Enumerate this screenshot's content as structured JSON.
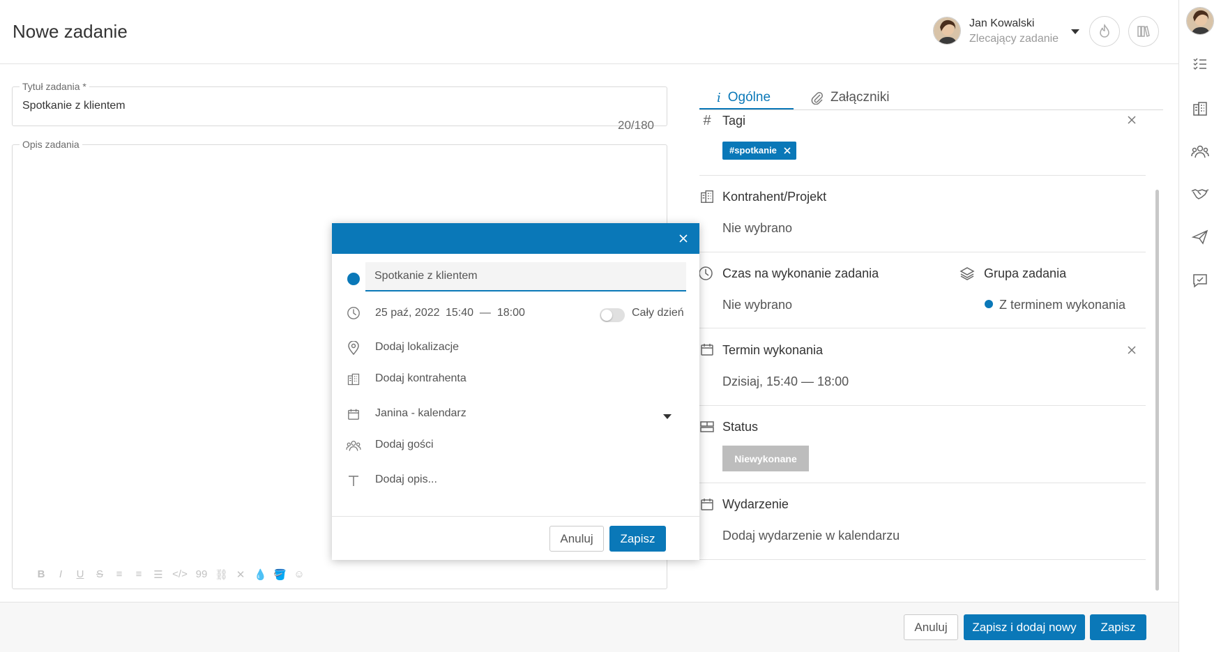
{
  "header": {
    "title": "Nowe zadanie",
    "user": {
      "name": "Jan Kowalski",
      "role": "Zlecający zadanie"
    }
  },
  "form": {
    "title_label": "Tytuł zadania *",
    "title_value": "Spotkanie z klientem",
    "title_counter": "20/180",
    "description_label": "Opis zadania"
  },
  "editor_toolbar": [
    "B",
    "I",
    "U",
    "S",
    "≡",
    "≡",
    "☰",
    "</>",
    "99",
    "⛓",
    "✕",
    "💧",
    "🪣",
    "☺"
  ],
  "tabs": [
    {
      "label": "Ogólne",
      "icon": "info-icon"
    },
    {
      "label": "Załączniki",
      "icon": "paperclip-icon"
    }
  ],
  "panel": {
    "tags": {
      "title": "Tagi",
      "chip": "#spotkanie"
    },
    "contractor": {
      "title": "Kontrahent/Projekt",
      "value": "Nie wybrano"
    },
    "time": {
      "title": "Czas na wykonanie zadania",
      "value": "Nie wybrano"
    },
    "group": {
      "title": "Grupa zadania",
      "value": "Z terminem wykonania",
      "color": "#0a78b8"
    },
    "deadline": {
      "title": "Termin wykonania",
      "value": "Dzisiaj, 15:40 — 18:00"
    },
    "status": {
      "title": "Status",
      "value": "Niewykonane"
    },
    "event": {
      "title": "Wydarzenie",
      "value": "Dodaj wydarzenie w kalendarzu"
    }
  },
  "modal": {
    "title_value": "Spotkanie z klientem",
    "date": "25 paź, 2022",
    "time_range": "15:40  —  18:00",
    "all_day_label": "Cały dzień",
    "location": "Dodaj lokalizacje",
    "contractor": "Dodaj kontrahenta",
    "calendar": "Janina - kalendarz",
    "guests": "Dodaj gości",
    "description": "Dodaj opis...",
    "cancel": "Anuluj",
    "save": "Zapisz"
  },
  "footer": {
    "cancel": "Anuluj",
    "save_and_new": "Zapisz i dodaj nowy",
    "save": "Zapisz"
  },
  "colors": {
    "accent": "#0a78b8",
    "status_gray": "#bdbdbd"
  }
}
